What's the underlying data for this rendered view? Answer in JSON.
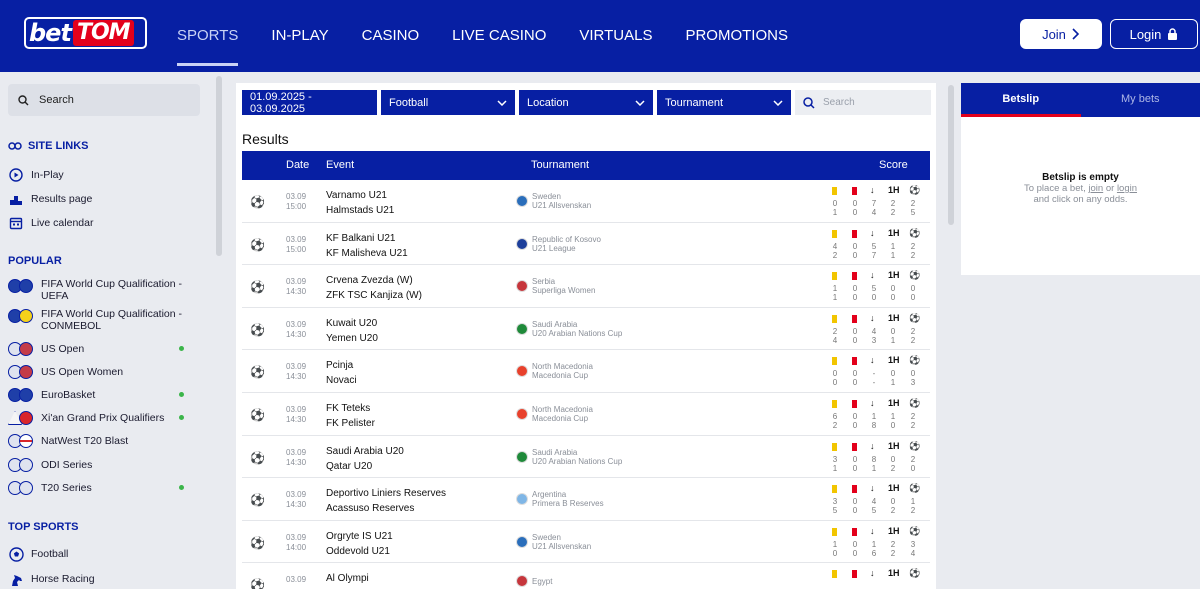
{
  "header": {
    "logo_left": "bet",
    "logo_right": "TOM",
    "nav": [
      "SPORTS",
      "IN-PLAY",
      "CASINO",
      "LIVE CASINO",
      "VIRTUALS",
      "PROMOTIONS"
    ],
    "join_label": "Join",
    "login_label": "Login"
  },
  "sidebar": {
    "search_label": "Search",
    "site_links_heading": "SITE LINKS",
    "site_links": [
      "In-Play",
      "Results page",
      "Live calendar"
    ],
    "popular_heading": "POPULAR",
    "popular": [
      {
        "label": "FIFA World Cup Qualification - UEFA",
        "live": false
      },
      {
        "label": "FIFA World Cup Qualification - CONMEBOL",
        "live": false
      },
      {
        "label": "US Open",
        "live": true
      },
      {
        "label": "US Open Women",
        "live": false
      },
      {
        "label": "EuroBasket",
        "live": true
      },
      {
        "label": "Xi'an Grand Prix Qualifiers",
        "live": true
      },
      {
        "label": "NatWest T20 Blast",
        "live": false
      },
      {
        "label": "ODI Series",
        "live": false
      },
      {
        "label": "T20 Series",
        "live": true
      }
    ],
    "top_sports_heading": "TOP SPORTS",
    "top_sports": [
      "Football",
      "Horse Racing"
    ]
  },
  "filters": {
    "date_range": "01.09.2025 - 03.09.2025",
    "sport": "Football",
    "location": "Location",
    "tournament": "Tournament",
    "search_placeholder": "Search"
  },
  "results": {
    "title": "Results",
    "columns": {
      "date": "Date",
      "event": "Event",
      "tournament": "Tournament",
      "score": "Score"
    },
    "score_headers": {
      "half": "1H"
    },
    "rows": [
      {
        "date": "03.09",
        "time": "15:00",
        "home": "Varnamo U21",
        "away": "Halmstads U21",
        "country": "Sweden",
        "league": "U21 Allsvenskan",
        "flag": "#2a6ebb",
        "cards_y": true,
        "cards_r": true,
        "s": [
          [
            "0",
            "0",
            "7",
            "2",
            "2"
          ],
          [
            "1",
            "0",
            "4",
            "2",
            "5"
          ]
        ]
      },
      {
        "date": "03.09",
        "time": "15:00",
        "home": "KF Balkani U21",
        "away": "KF Malisheva U21",
        "country": "Republic of Kosovo",
        "league": "U21 League",
        "flag": "#1d3f9b",
        "cards_y": false,
        "cards_r": false,
        "s": [
          [
            "4",
            "0",
            "5",
            "1",
            "2"
          ],
          [
            "2",
            "0",
            "7",
            "1",
            "2"
          ]
        ]
      },
      {
        "date": "03.09",
        "time": "14:30",
        "home": "Crvena Zvezda (W)",
        "away": "ZFK TSC Kanjiza (W)",
        "country": "Serbia",
        "league": "Superliga Women",
        "flag": "#c6363c",
        "cards_y": true,
        "cards_r": true,
        "s": [
          [
            "1",
            "0",
            "5",
            "0",
            "0"
          ],
          [
            "1",
            "0",
            "0",
            "0",
            "0"
          ]
        ]
      },
      {
        "date": "03.09",
        "time": "14:30",
        "home": "Kuwait U20",
        "away": "Yemen U20",
        "country": "Saudi Arabia",
        "league": "U20 Arabian Nations Cup",
        "flag": "#1f8a3a",
        "cards_y": false,
        "cards_r": false,
        "s": [
          [
            "2",
            "0",
            "4",
            "0",
            "2"
          ],
          [
            "4",
            "0",
            "3",
            "1",
            "2"
          ]
        ]
      },
      {
        "date": "03.09",
        "time": "14:30",
        "home": "Pcinja",
        "away": "Novaci",
        "country": "North Macedonia",
        "league": "Macedonia Cup",
        "flag": "#e8412c",
        "cards_y": false,
        "cards_r": false,
        "s": [
          [
            "0",
            "0",
            "-",
            "0",
            "0"
          ],
          [
            "0",
            "0",
            "-",
            "1",
            "3"
          ]
        ]
      },
      {
        "date": "03.09",
        "time": "14:30",
        "home": "FK Teteks",
        "away": "FK Pelister",
        "country": "North Macedonia",
        "league": "Macedonia Cup",
        "flag": "#e8412c",
        "cards_y": false,
        "cards_r": false,
        "s": [
          [
            "6",
            "0",
            "1",
            "1",
            "2"
          ],
          [
            "2",
            "0",
            "8",
            "0",
            "2"
          ]
        ]
      },
      {
        "date": "03.09",
        "time": "14:30",
        "home": "Saudi Arabia U20",
        "away": "Qatar U20",
        "country": "Saudi Arabia",
        "league": "U20 Arabian Nations Cup",
        "flag": "#1f8a3a",
        "cards_y": false,
        "cards_r": false,
        "s": [
          [
            "3",
            "0",
            "8",
            "0",
            "2"
          ],
          [
            "1",
            "0",
            "1",
            "2",
            "0"
          ]
        ]
      },
      {
        "date": "03.09",
        "time": "14:30",
        "home": "Deportivo Liniers Reserves",
        "away": "Acassuso Reserves",
        "country": "Argentina",
        "league": "Primera B Reserves",
        "flag": "#7fb6e6",
        "cards_y": true,
        "cards_r": true,
        "s": [
          [
            "3",
            "0",
            "4",
            "0",
            "1"
          ],
          [
            "5",
            "0",
            "5",
            "2",
            "2"
          ]
        ]
      },
      {
        "date": "03.09",
        "time": "14:00",
        "home": "Orgryte IS U21",
        "away": "Oddevold U21",
        "country": "Sweden",
        "league": "U21 Allsvenskan",
        "flag": "#2a6ebb",
        "cards_y": true,
        "cards_r": true,
        "s": [
          [
            "1",
            "0",
            "1",
            "2",
            "3"
          ],
          [
            "0",
            "0",
            "6",
            "2",
            "4"
          ]
        ]
      },
      {
        "date": "03.09",
        "time": "",
        "home": "Al Olympi",
        "away": "",
        "country": "Egypt",
        "league": "",
        "flag": "#c6363c",
        "cards_y": true,
        "cards_r": true,
        "s": [
          [
            "",
            "",
            "",
            "",
            ""
          ],
          [
            "",
            "",
            "",
            "",
            ""
          ]
        ]
      }
    ]
  },
  "betslip": {
    "tab_active": "Betslip",
    "tab_other": "My bets",
    "empty_title": "Betslip is empty",
    "hint_1": "To place a bet,",
    "hint_join": "join",
    "hint_or": "or",
    "hint_login": "login",
    "hint_2": "and click on any odds."
  },
  "colors": {
    "brand": "#071fa3",
    "accent": "#e3001b",
    "live_dot": "#3bb54a"
  }
}
